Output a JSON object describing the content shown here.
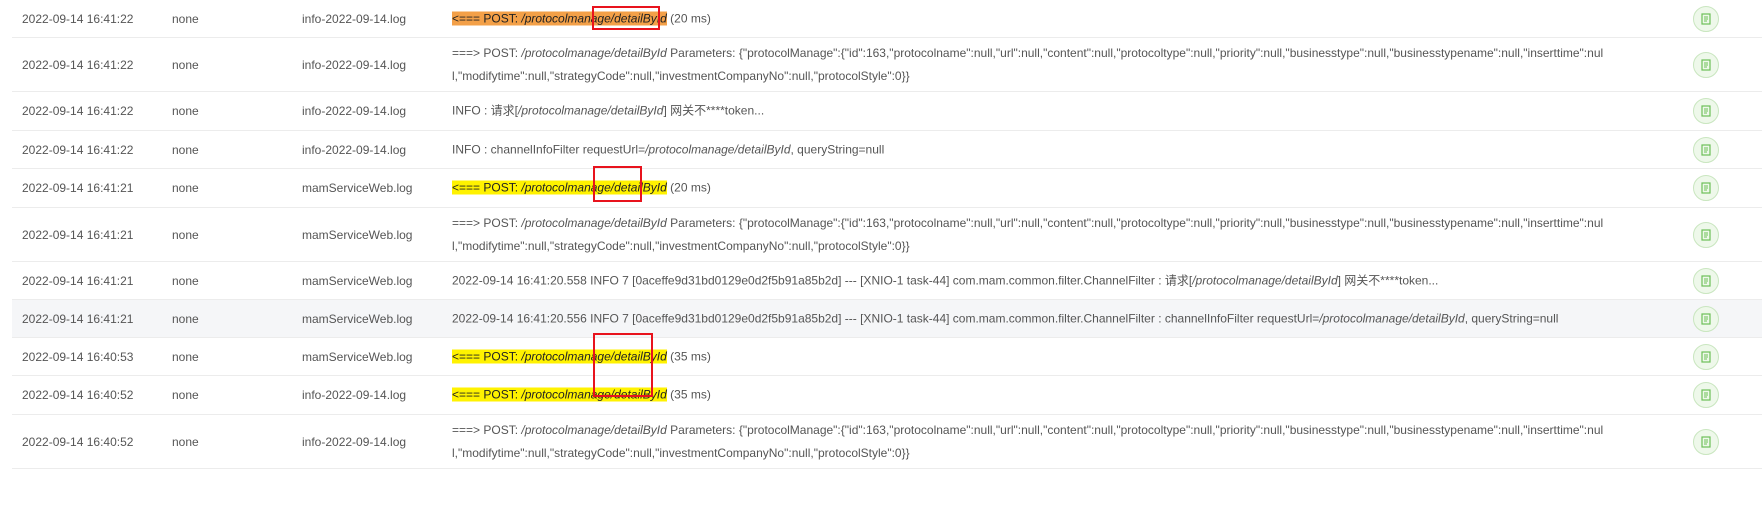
{
  "rows": [
    {
      "time": "2022-09-14 16:41:22",
      "user": "none",
      "file": "info-2022-09-14.log",
      "type": "hl",
      "hl_color": "orange",
      "prefix": "<=== POST: ",
      "path": "/protocolmanage/detailById",
      "duration": "(20 ms)"
    },
    {
      "time": "2022-09-14 16:41:22",
      "user": "none",
      "file": "info-2022-09-14.log",
      "type": "params",
      "prefix": "===> POST: ",
      "path": "/protocolmanage/detailById",
      "line1": " Parameters: {\"protocolManage\":{\"id\":163,\"protocolname\":null,\"url\":null,\"content\":null,\"protocoltype\":null,\"priority\":null,\"businesstype\":null,\"businesstypename\":null,\"inserttime\":nul",
      "line2": "l,\"modifytime\":null,\"strategyCode\":null,\"investmentCompanyNo\":null,\"protocolStyle\":0}}"
    },
    {
      "time": "2022-09-14 16:41:22",
      "user": "none",
      "file": "info-2022-09-14.log",
      "type": "text",
      "pre": "INFO : 请求[",
      "path": "/protocolmanage/detailById",
      "post": "] 网关不****token..."
    },
    {
      "time": "2022-09-14 16:41:22",
      "user": "none",
      "file": "info-2022-09-14.log",
      "type": "text",
      "pre": "INFO : channelInfoFilter requestUrl=",
      "path": "/protocolmanage/detailById",
      "post": ", queryString=null"
    },
    {
      "time": "2022-09-14 16:41:21",
      "user": "none",
      "file": "mamServiceWeb.log",
      "type": "hl",
      "hl_color": "yellow",
      "prefix": "<=== POST: ",
      "path": "/protocolmanage/detailById",
      "duration": "(20 ms)"
    },
    {
      "time": "2022-09-14 16:41:21",
      "user": "none",
      "file": "mamServiceWeb.log",
      "type": "params",
      "prefix": "===> POST: ",
      "path": "/protocolmanage/detailById",
      "line1": " Parameters: {\"protocolManage\":{\"id\":163,\"protocolname\":null,\"url\":null,\"content\":null,\"protocoltype\":null,\"priority\":null,\"businesstype\":null,\"businesstypename\":null,\"inserttime\":nul",
      "line2": "l,\"modifytime\":null,\"strategyCode\":null,\"investmentCompanyNo\":null,\"protocolStyle\":0}}"
    },
    {
      "time": "2022-09-14 16:41:21",
      "user": "none",
      "file": "mamServiceWeb.log",
      "type": "text",
      "pre": "2022-09-14 16:41:20.558 INFO 7 [0aceffe9d31bd0129e0d2f5b91a85b2d] --- [XNIO-1 task-44] com.mam.common.filter.ChannelFilter : 请求[",
      "path": "/protocolmanage/detailById",
      "post": "] 网关不****token..."
    },
    {
      "time": "2022-09-14 16:41:21",
      "user": "none",
      "file": "mamServiceWeb.log",
      "type": "text",
      "hover": true,
      "pre": "2022-09-14 16:41:20.556 INFO 7 [0aceffe9d31bd0129e0d2f5b91a85b2d] --- [XNIO-1 task-44] com.mam.common.filter.ChannelFilter : channelInfoFilter requestUrl=",
      "path": "/protocolmanage/detailById",
      "post": ", queryString=null"
    },
    {
      "time": "2022-09-14 16:40:53",
      "user": "none",
      "file": "mamServiceWeb.log",
      "type": "hl",
      "hl_color": "yellow",
      "prefix": "<=== POST: ",
      "path": "/protocolmanage/detailById",
      "duration": "(35 ms)"
    },
    {
      "time": "2022-09-14 16:40:52",
      "user": "none",
      "file": "info-2022-09-14.log",
      "type": "hl",
      "hl_color": "yellow",
      "prefix": "<=== POST: ",
      "path": "/protocolmanage/detailById",
      "duration": "(35 ms)"
    },
    {
      "time": "2022-09-14 16:40:52",
      "user": "none",
      "file": "info-2022-09-14.log",
      "type": "params",
      "prefix": "===> POST: ",
      "path": "/protocolmanage/detailById",
      "line1": " Parameters: {\"protocolManage\":{\"id\":163,\"protocolname\":null,\"url\":null,\"content\":null,\"protocoltype\":null,\"priority\":null,\"businesstype\":null,\"businesstypename\":null,\"inserttime\":nul",
      "line2": "l,\"modifytime\":null,\"strategyCode\":null,\"investmentCompanyNo\":null,\"protocolStyle\":0}}"
    }
  ],
  "action_icon": "document-icon",
  "colors": {
    "highlight_orange": "#f3a048",
    "highlight_yellow": "#fff200",
    "annotation_box": "#e8131d",
    "icon_green": "#6cbf57"
  }
}
